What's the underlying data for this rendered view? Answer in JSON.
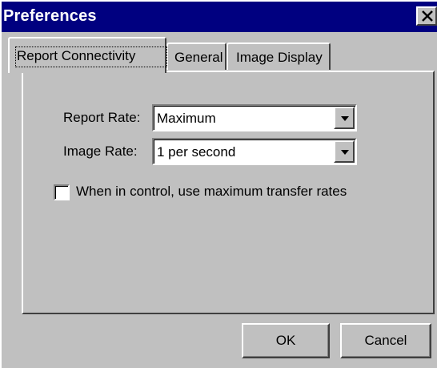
{
  "window": {
    "title": "Preferences",
    "close_icon": "close-x-icon"
  },
  "tabs": [
    {
      "label": "Report Connectivity",
      "active": true
    },
    {
      "label": "General",
      "active": false
    },
    {
      "label": "Image Display",
      "active": false
    }
  ],
  "form": {
    "report_rate_label": "Report Rate:",
    "report_rate_value": "Maximum",
    "image_rate_label": "Image Rate:",
    "image_rate_value": "1 per second",
    "checkbox_label": "When in control, use maximum transfer rates",
    "checkbox_checked": false
  },
  "buttons": {
    "ok": "OK",
    "cancel": "Cancel"
  },
  "colors": {
    "title_bar": "#000080",
    "face": "#c0c0c0"
  }
}
